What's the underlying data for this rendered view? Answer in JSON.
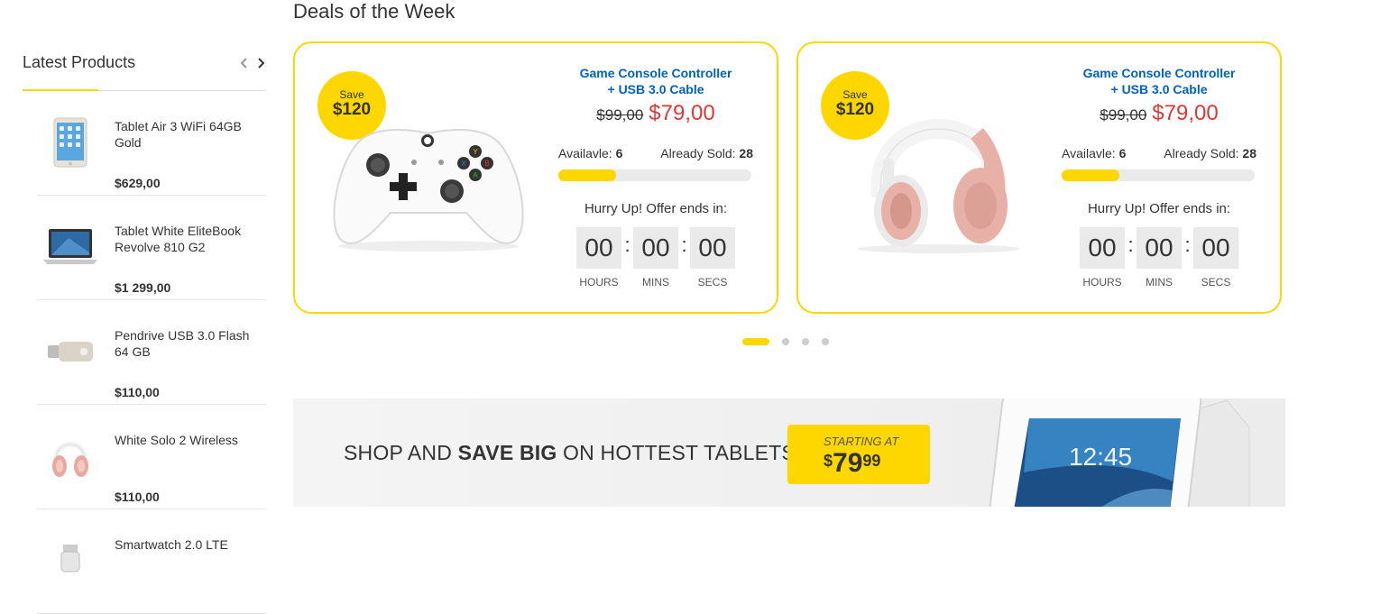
{
  "sidebar": {
    "title": "Latest Products",
    "items": [
      {
        "name": "Tablet Air 3 WiFi 64GB Gold",
        "price": "$629,00",
        "icon": "tablet-gold-icon"
      },
      {
        "name": "Tablet White EliteBook Revolve 810 G2",
        "price": "$1 299,00",
        "icon": "laptop-icon"
      },
      {
        "name": "Pendrive USB 3.0 Flash 64 GB",
        "price": "$110,00",
        "icon": "usb-drive-icon"
      },
      {
        "name": "White Solo 2 Wireless",
        "price": "$110,00",
        "icon": "headphones-icon"
      },
      {
        "name": "Smartwatch 2.0 LTE",
        "price": "",
        "icon": "smartwatch-icon"
      }
    ]
  },
  "deals": {
    "title": "Deals of the Week",
    "cards": [
      {
        "save_label": "Save",
        "save_amount": "$120",
        "name_line1": "Game Console Controller",
        "name_line2": "+ USB 3.0 Cable",
        "old_price": "$99,00",
        "new_price": "$79,00",
        "available_label": "Availavle:",
        "available": "6",
        "sold_label": "Already Sold:",
        "sold": "28",
        "sold_fraction": 0.3,
        "hurry": "Hurry Up! Offer ends in:",
        "hours": "00",
        "mins": "00",
        "secs": "00",
        "hours_label": "HOURS",
        "mins_label": "MINS",
        "secs_label": "SECS",
        "image": "game-controller-icon"
      },
      {
        "save_label": "Save",
        "save_amount": "$120",
        "name_line1": "Game Console Controller",
        "name_line2": "+ USB 3.0 Cable",
        "old_price": "$99,00",
        "new_price": "$79,00",
        "available_label": "Availavle:",
        "available": "6",
        "sold_label": "Already Sold:",
        "sold": "28",
        "sold_fraction": 0.3,
        "hurry": "Hurry Up! Offer ends in:",
        "hours": "00",
        "mins": "00",
        "secs": "00",
        "hours_label": "HOURS",
        "mins_label": "MINS",
        "secs_label": "SECS",
        "image": "headphones-icon"
      }
    ],
    "pagination": {
      "count": 4,
      "active": 0
    }
  },
  "banner": {
    "text_pre": "SHOP AND ",
    "text_bold": "SAVE BIG",
    "text_post": " ON HOTTEST TABLETS",
    "starting_label": "STARTING AT",
    "currency": "$",
    "price_int": "79",
    "price_cents": "99",
    "image": "tablet-icon"
  },
  "colors": {
    "accent": "#fed700",
    "link": "#0062bd",
    "sale": "#df3737"
  }
}
